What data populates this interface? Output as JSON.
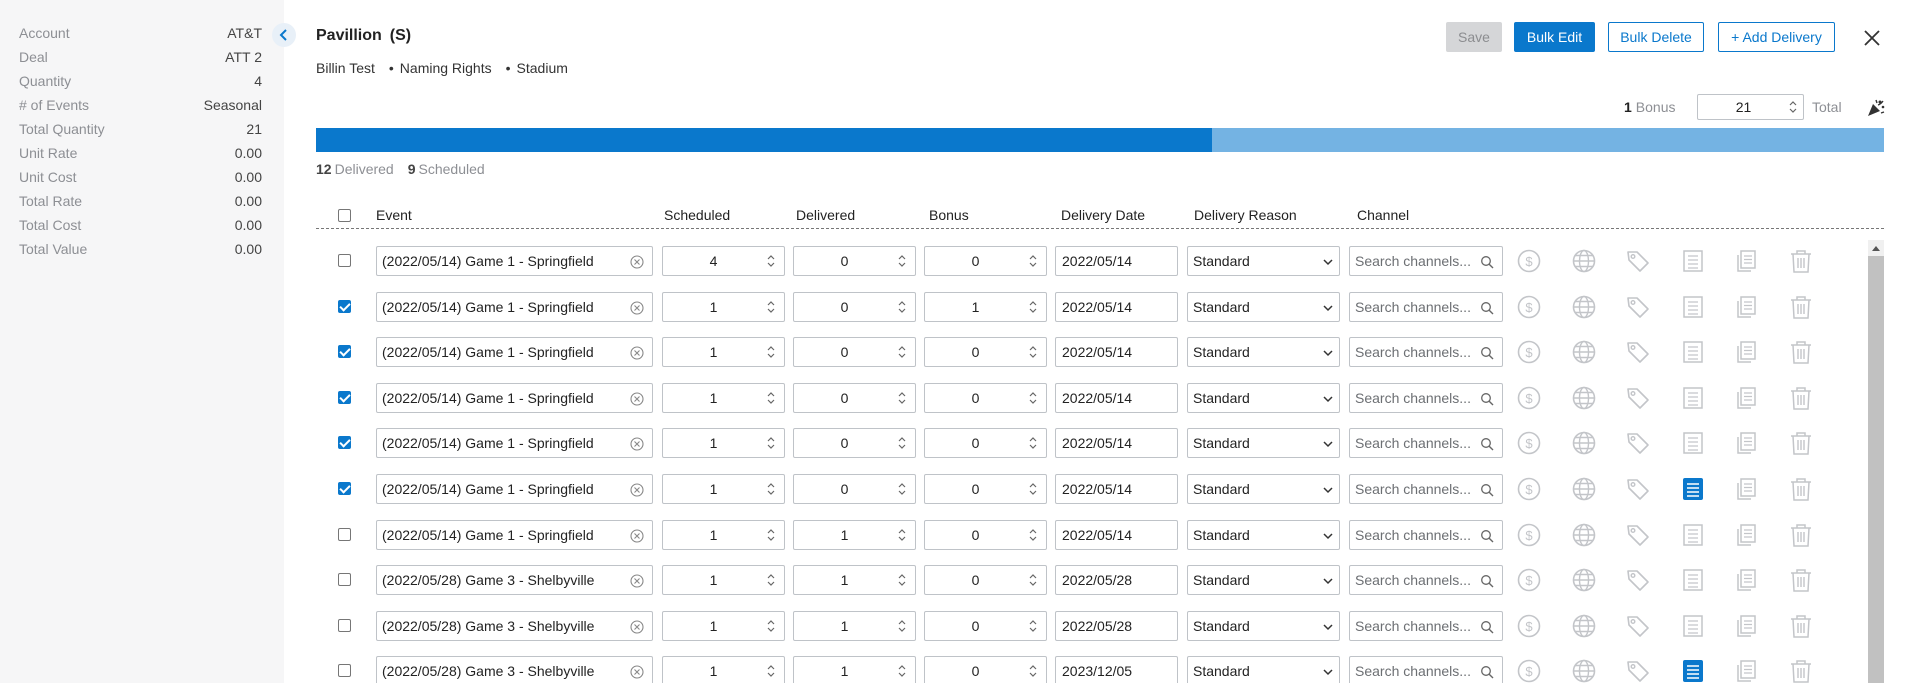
{
  "sidebar": {
    "rows": [
      {
        "label": "Account",
        "value": "AT&T"
      },
      {
        "label": "Deal",
        "value": "ATT 2"
      },
      {
        "label": "Quantity",
        "value": "4"
      },
      {
        "label": "# of Events",
        "value": "Seasonal"
      },
      {
        "label": "Total Quantity",
        "value": "21"
      },
      {
        "label": "Unit Rate",
        "value": "0.00"
      },
      {
        "label": "Unit Cost",
        "value": "0.00"
      },
      {
        "label": "Total Rate",
        "value": "0.00"
      },
      {
        "label": "Total Cost",
        "value": "0.00"
      },
      {
        "label": "Total Value",
        "value": "0.00"
      }
    ]
  },
  "header": {
    "title": "Pavillion",
    "subtitle": "(S)",
    "tags": [
      "Billin Test",
      "Naming Rights",
      "Stadium"
    ],
    "buttons": {
      "save": "Save",
      "bulk_edit": "Bulk Edit",
      "bulk_delete": "Bulk Delete",
      "add_delivery": "+ Add Delivery"
    }
  },
  "totals": {
    "bonus_count": "1",
    "bonus_label": "Bonus",
    "total_value": "21",
    "total_label": "Total"
  },
  "progress": {
    "delivered": "12",
    "delivered_label": "Delivered",
    "scheduled": "9",
    "scheduled_label": "Scheduled",
    "delivered_fraction": 0.5714
  },
  "table": {
    "headers": {
      "event": "Event",
      "scheduled": "Scheduled",
      "delivered": "Delivered",
      "bonus": "Bonus",
      "delivery_date": "Delivery Date",
      "delivery_reason": "Delivery Reason",
      "channel": "Channel"
    },
    "channel_placeholder": "Search channels...",
    "rows": [
      {
        "checked": false,
        "event": "(2022/05/14) Game 1 - Springfield",
        "scheduled": "4",
        "delivered": "0",
        "bonus": "0",
        "date": "2022/05/14",
        "reason": "Standard",
        "notes_active": false
      },
      {
        "checked": true,
        "event": "(2022/05/14) Game 1 - Springfield",
        "scheduled": "1",
        "delivered": "0",
        "bonus": "1",
        "date": "2022/05/14",
        "reason": "Standard",
        "notes_active": false
      },
      {
        "checked": true,
        "event": "(2022/05/14) Game 1 - Springfield",
        "scheduled": "1",
        "delivered": "0",
        "bonus": "0",
        "date": "2022/05/14",
        "reason": "Standard",
        "notes_active": false
      },
      {
        "checked": true,
        "event": "(2022/05/14) Game 1 - Springfield",
        "scheduled": "1",
        "delivered": "0",
        "bonus": "0",
        "date": "2022/05/14",
        "reason": "Standard",
        "notes_active": false
      },
      {
        "checked": true,
        "event": "(2022/05/14) Game 1 - Springfield",
        "scheduled": "1",
        "delivered": "0",
        "bonus": "0",
        "date": "2022/05/14",
        "reason": "Standard",
        "notes_active": false
      },
      {
        "checked": true,
        "event": "(2022/05/14) Game 1 - Springfield",
        "scheduled": "1",
        "delivered": "0",
        "bonus": "0",
        "date": "2022/05/14",
        "reason": "Standard",
        "notes_active": true
      },
      {
        "checked": false,
        "event": "(2022/05/14) Game 1 - Springfield",
        "scheduled": "1",
        "delivered": "1",
        "bonus": "0",
        "date": "2022/05/14",
        "reason": "Standard",
        "notes_active": false
      },
      {
        "checked": false,
        "event": "(2022/05/28) Game 3 - Shelbyville",
        "scheduled": "1",
        "delivered": "1",
        "bonus": "0",
        "date": "2022/05/28",
        "reason": "Standard",
        "notes_active": false
      },
      {
        "checked": false,
        "event": "(2022/05/28) Game 3 - Shelbyville",
        "scheduled": "1",
        "delivered": "1",
        "bonus": "0",
        "date": "2022/05/28",
        "reason": "Standard",
        "notes_active": false
      },
      {
        "checked": false,
        "event": "(2022/05/28) Game 3 - Shelbyville",
        "scheduled": "1",
        "delivered": "1",
        "bonus": "0",
        "date": "2023/12/05",
        "reason": "Standard",
        "notes_active": true
      }
    ]
  },
  "colors": {
    "primary": "#0a78cc",
    "progress_remaining": "#74b3e3",
    "icon_gray": "#c3c5c9"
  },
  "icons": [
    "chevron-left-icon",
    "close-icon",
    "confetti-icon",
    "clear-icon",
    "spinner-icon",
    "chevron-down-icon",
    "search-icon",
    "dollar-icon",
    "globe-icon",
    "tag-icon",
    "notes-icon",
    "copy-icon",
    "trash-icon"
  ]
}
